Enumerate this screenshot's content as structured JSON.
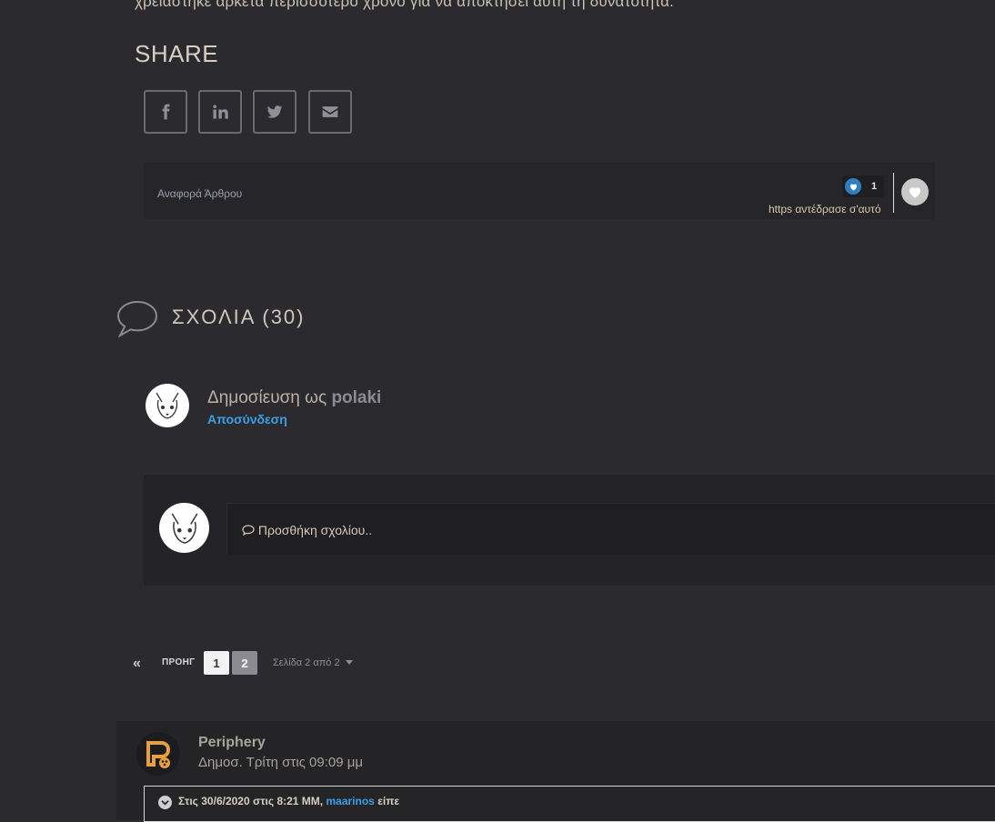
{
  "article": {
    "cut_text": "χρειάστηκε αρκετά περισσότερο χρόνο για να αποκτήσει αυτή τη δυνατότητα.",
    "share_title": "SHARE",
    "share_buttons": [
      {
        "icon": "facebook-icon"
      },
      {
        "icon": "linkedin-icon"
      },
      {
        "icon": "twitter-icon"
      },
      {
        "icon": "email-icon"
      }
    ]
  },
  "reactions": {
    "report_label": "Αναφορά Άρθρου",
    "count": "1",
    "who_reacted": "https αντέδρασε σ'αυτό",
    "heart_color": "#2d7fc2"
  },
  "comments": {
    "title": "ΣΧΟΛΙΑ (30)",
    "posting_as_prefix": "Δημοσίευση ως",
    "username": "polaki",
    "signout_label": "Αποσύνδεση",
    "add_comment_placeholder": "Προσθήκη σχολίου.."
  },
  "pagination": {
    "first_symbol": "«",
    "prev_label": "ΠΡΟΗΓ",
    "pages": [
      "1",
      "2"
    ],
    "current_page": "2",
    "info_label": "Σελίδα 2 από 2"
  },
  "post": {
    "author": "Periphery",
    "date": "Δημοσ. Τρίτη στις 09:09 μμ",
    "quote_prefix": "Στις 30/6/2020 στις 8:21 MM,",
    "quote_user": "maarinos",
    "quote_suffix": "είπε"
  },
  "colors": {
    "background": "#2b2b2f",
    "link_blue": "#3aa0e6",
    "accent_orange": "#e8a13a"
  }
}
